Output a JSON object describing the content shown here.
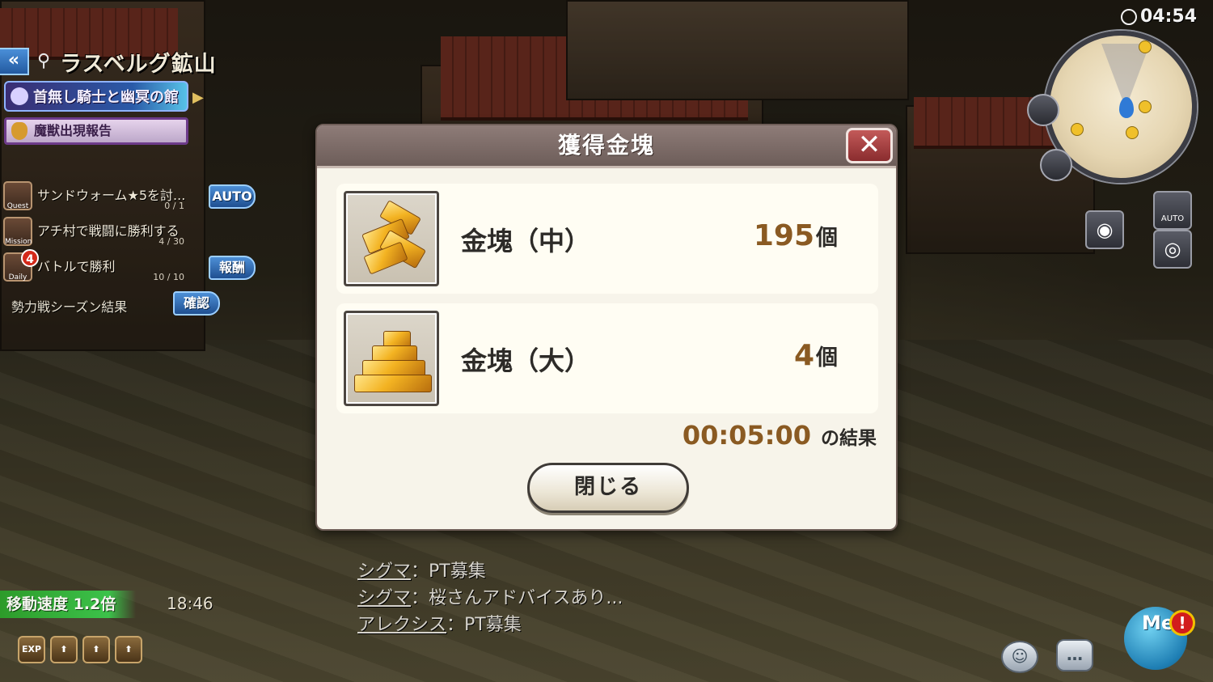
{
  "hud": {
    "location": "ラスベルグ鉱山",
    "banner_event": "首無し騎士と幽冥の館",
    "banner_report": "魔獣出現報告",
    "quests": [
      {
        "tag": "Quest",
        "text": "サンドウォーム★5を討...",
        "count": "0 / 1",
        "button": "AUTO"
      },
      {
        "tag": "Mission",
        "text": "アチ村で戦闘に勝利する",
        "count": "4 / 30",
        "button": ""
      },
      {
        "tag": "Daily",
        "text": "バトルで勝利",
        "count": "10 / 10",
        "button": "報酬",
        "badge": "4"
      }
    ],
    "season_text": "勢力戦シーズン結果",
    "season_button": "確認",
    "speed_label": "移動速度 1.2倍",
    "speed_timer": "18:46",
    "buffs": [
      "EXP",
      "",
      "",
      ""
    ],
    "clock": "04:54",
    "auto_label": "AUTO",
    "me_label": "Me"
  },
  "chat": [
    {
      "who": "シグマ",
      "msg": "：PT募集"
    },
    {
      "who": "シグマ",
      "msg": "：桜さんアドバイスあり..."
    },
    {
      "who": "アレクシス",
      "msg": "：PT募集"
    }
  ],
  "modal": {
    "title": "獲得金塊",
    "close_symbol": "✕",
    "items": [
      {
        "name": "金塊（中）",
        "qty": "195",
        "unit": "個",
        "icon": "gold-bars-medium-icon"
      },
      {
        "name": "金塊（大）",
        "qty": "4",
        "unit": "個",
        "icon": "gold-bars-large-icon"
      }
    ],
    "duration": "00:05:00",
    "result_suffix": "の結果",
    "close_button": "閉じる"
  },
  "colors": {
    "modal_header": "#7d6b67",
    "quantity_text": "#8a5a22",
    "hud_blue": "#2f6bb8",
    "speed_green": "#2d9b2a"
  }
}
